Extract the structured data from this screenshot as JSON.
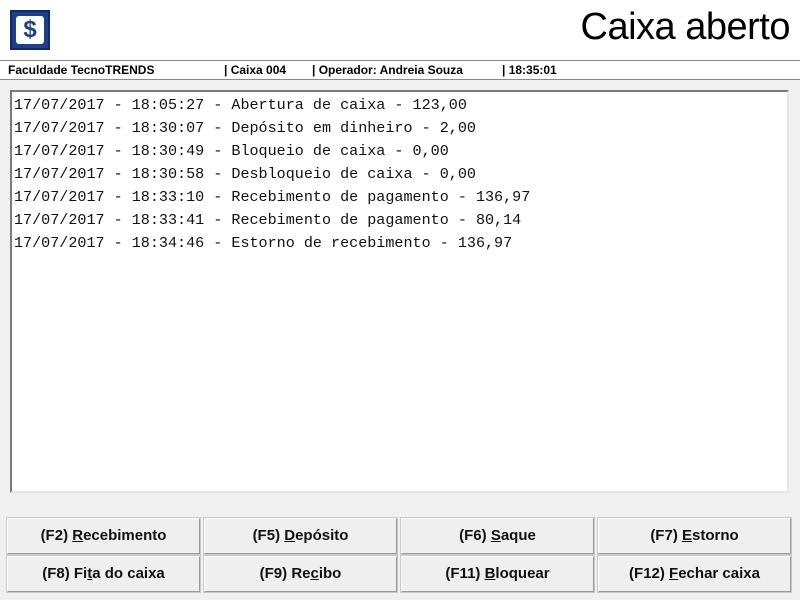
{
  "header": {
    "logo_glyph": "$",
    "title": "Caixa aberto"
  },
  "status": {
    "company": "Faculdade TecnoTRENDS",
    "register": "| Caixa 004",
    "operator": "| Operador: Andreia Souza",
    "time": "| 18:35:01"
  },
  "log": {
    "lines": [
      "17/07/2017 - 18:05:27 - Abertura de caixa - 123,00",
      "17/07/2017 - 18:30:07 - Depósito em dinheiro - 2,00",
      "17/07/2017 - 18:30:49 - Bloqueio de caixa - 0,00",
      "17/07/2017 - 18:30:58 - Desbloqueio de caixa - 0,00",
      "17/07/2017 - 18:33:10 - Recebimento de pagamento - 136,97",
      "17/07/2017 - 18:33:41 - Recebimento de pagamento - 80,14",
      "17/07/2017 - 18:34:46 - Estorno de recebimento - 136,97"
    ]
  },
  "buttons": [
    {
      "key": "(F2)",
      "pre": "",
      "acc": "R",
      "post": "ecebimento"
    },
    {
      "key": "(F5)",
      "pre": "",
      "acc": "D",
      "post": "epósito"
    },
    {
      "key": "(F6)",
      "pre": "",
      "acc": "S",
      "post": "aque"
    },
    {
      "key": "(F7)",
      "pre": "",
      "acc": "E",
      "post": "storno"
    },
    {
      "key": "(F8)",
      "pre": "Fi",
      "acc": "t",
      "post": "a do caixa"
    },
    {
      "key": "(F9)",
      "pre": "Re",
      "acc": "c",
      "post": "ibo"
    },
    {
      "key": "(F11)",
      "pre": "",
      "acc": "B",
      "post": "loquear"
    },
    {
      "key": "(F12)",
      "pre": "",
      "acc": "F",
      "post": "echar caixa"
    }
  ],
  "colors": {
    "brand": "#1c3f8e",
    "panel_background": "#f0f0f0"
  }
}
